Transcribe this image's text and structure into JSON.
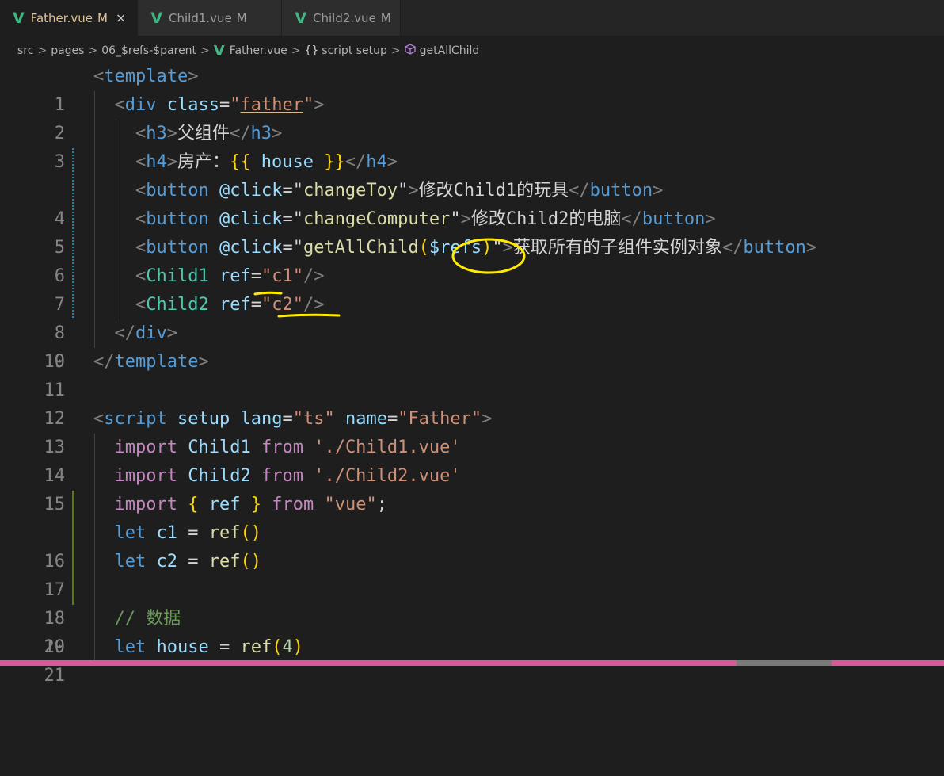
{
  "tabs": [
    {
      "file": "Father.vue",
      "status": "M",
      "close": "×",
      "active": true
    },
    {
      "file": "Child1.vue",
      "status": "M",
      "active": false
    },
    {
      "file": "Child2.vue",
      "status": "M",
      "active": false
    }
  ],
  "breadcrumb": {
    "items": [
      "src",
      "pages",
      "06_$refs-$parent",
      "Father.vue",
      "script setup",
      "getAllChild"
    ],
    "separator": ">",
    "braces": "{}"
  },
  "icons": {
    "vue": "vue-file-icon",
    "method": "cube-method-icon"
  },
  "colors": {
    "vue_green": "#41b883",
    "annotation": "#ffea00",
    "modified_gutter": "#1b81a8",
    "added_gutter": "#587c0c"
  },
  "code": {
    "l1": "<template>",
    "l2": {
      "open": "<",
      "tag": "div",
      "attr": "class",
      "eq": "=\"",
      "val": "father",
      "end": "\">"
    },
    "l3": {
      "text": "父组件"
    },
    "l4": {
      "text": "房产：",
      "var": "house"
    },
    "l5": {
      "fn": "changeToy",
      "text": "修改Child1的玩具"
    },
    "l6": {
      "fn": "changeComputer",
      "text": "修改Child2的电脑"
    },
    "l7": {
      "fn": "getAllChild",
      "arg": "$refs",
      "text": "获取所有的子组件实例对象"
    },
    "l8": {
      "comp": "Child1",
      "ref": "c1"
    },
    "l9": {
      "comp": "Child2",
      "ref": "c2"
    },
    "l10": "</div>",
    "l11": "</template>",
    "l13": {
      "lang": "ts",
      "name": "Father"
    },
    "l14": {
      "name": "Child1",
      "path": "'./Child1.vue'"
    },
    "l15": {
      "name": "Child2",
      "path": "'./Child2.vue'"
    },
    "l16": {
      "name": "ref",
      "path": "\"vue\""
    },
    "l17": {
      "var": "c1"
    },
    "l18": {
      "var": "c2"
    },
    "l20": "// 数据",
    "l21": {
      "var": "house",
      "num": "4"
    }
  }
}
